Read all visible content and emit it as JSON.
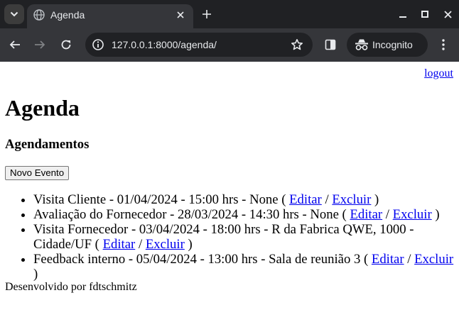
{
  "browser": {
    "tab_title": "Agenda",
    "url": "127.0.0.1:8000/agenda/",
    "incognito_label": "Incognito"
  },
  "page": {
    "logout_label": "logout",
    "title": "Agenda",
    "subtitle": "Agendamentos",
    "new_event_label": "Novo Evento",
    "edit_label": "Editar",
    "delete_label": "Excluir",
    "events": [
      {
        "text": "Visita Cliente - 01/04/2024 - 15:00 hrs - None ("
      },
      {
        "text": "Avaliação do Fornecedor - 28/03/2024 - 14:30 hrs - None ("
      },
      {
        "text": "Visita Fornecedor - 03/04/2024 - 18:00 hrs - R da Fabrica QWE, 1000 - Cidade/UF ("
      },
      {
        "text": "Feedback interno - 05/04/2024 - 13:00 hrs - Sala de reunião 3 ("
      }
    ],
    "footer": "Desenvolvido por fdtschmitz"
  },
  "colors": {
    "chrome_dark": "#202124",
    "chrome_toolbar": "#35363a",
    "link": "#0000ee"
  }
}
